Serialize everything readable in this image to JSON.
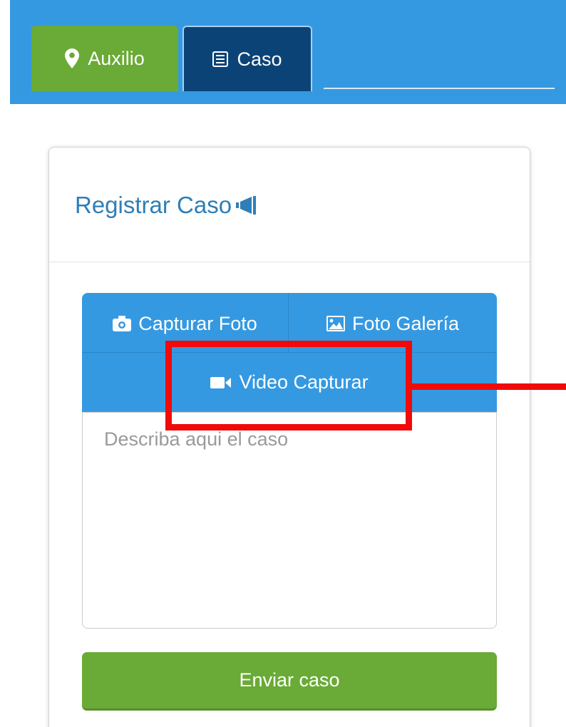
{
  "tabs": {
    "auxilio": {
      "label": "Auxilio",
      "icon": "map-marker-icon",
      "color": "#6aaa36"
    },
    "caso": {
      "label": "Caso",
      "icon": "list-icon",
      "color": "#0c4377"
    }
  },
  "card": {
    "title": "Registrar Caso",
    "title_icon": "megaphone-icon"
  },
  "media_buttons": {
    "capturar_foto": {
      "label": "Capturar Foto",
      "icon": "camera-icon"
    },
    "foto_galeria": {
      "label": "Foto Galería",
      "icon": "picture-icon"
    },
    "video_capturar": {
      "label": "Video Capturar",
      "icon": "video-camera-icon"
    }
  },
  "description": {
    "placeholder": "Describa aqui el caso",
    "value": ""
  },
  "submit": {
    "label": "Enviar caso"
  },
  "colors": {
    "header_blue": "#3599e1",
    "accent_green": "#6aaa36",
    "annotation_red": "#f00a0a"
  }
}
